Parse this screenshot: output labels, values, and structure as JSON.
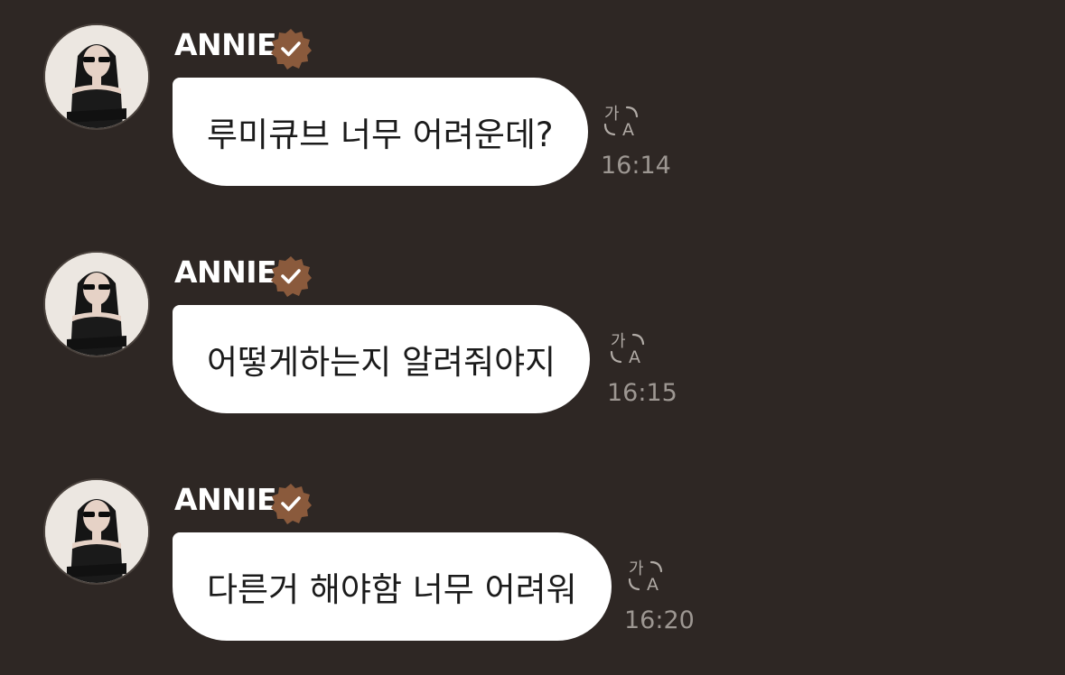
{
  "messages": [
    {
      "sender": "ANNIE",
      "text": "루미큐브 너무 어려운데?",
      "time": "16:14"
    },
    {
      "sender": "ANNIE",
      "text": "어떻게하는지 알려줘야지",
      "time": "16:15"
    },
    {
      "sender": "ANNIE",
      "text": "다른거 해야함 너무 어려워",
      "time": "16:20"
    }
  ],
  "icons": {
    "verified": "verified-badge-icon",
    "translate": "translate-icon",
    "translate_glyph": "가A"
  },
  "colors": {
    "background": "#2e2724",
    "bubble": "#ffffff",
    "badge": "#8a5a3c",
    "timestamp": "#9d9792"
  }
}
